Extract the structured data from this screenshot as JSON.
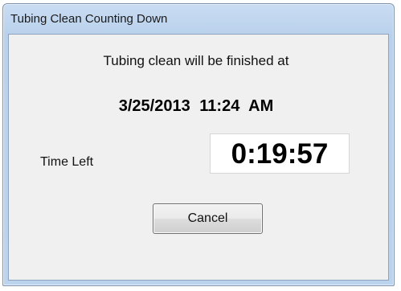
{
  "window": {
    "title": "Tubing Clean Counting Down"
  },
  "dialog": {
    "message": "Tubing clean will be finished at",
    "finish_time": "3/25/2013  11:24 AM",
    "time_left_label": "Time Left",
    "countdown_value": "0:19:57"
  },
  "buttons": {
    "cancel_label": "Cancel"
  }
}
